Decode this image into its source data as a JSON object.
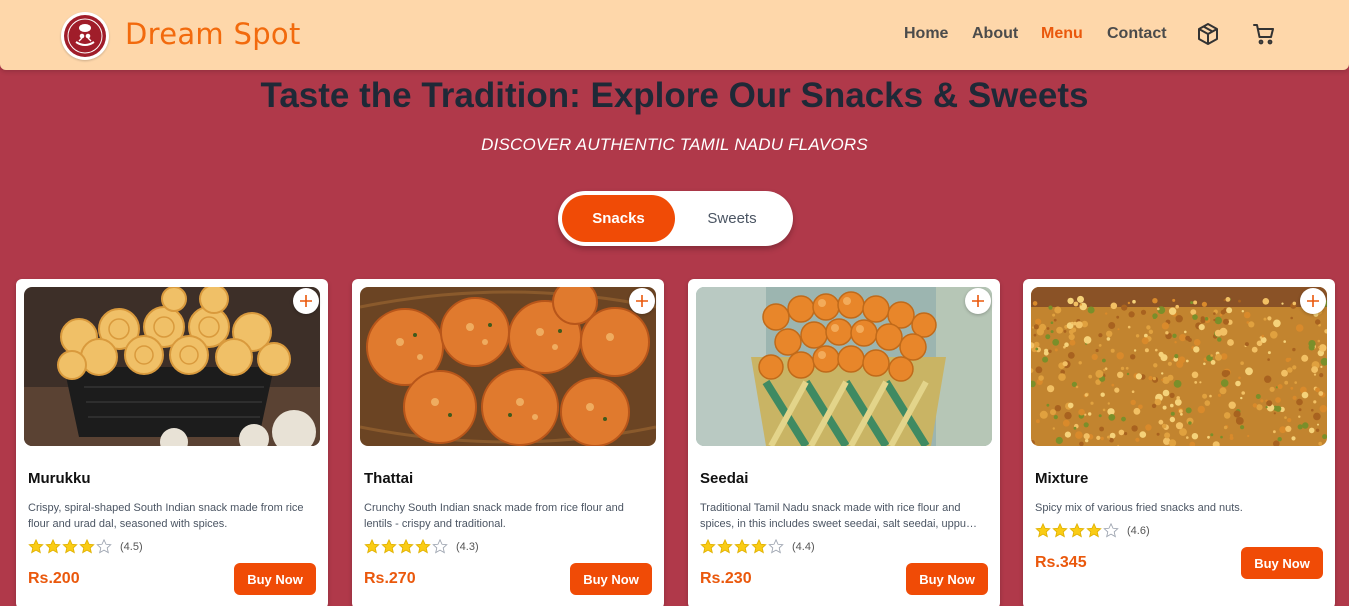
{
  "header": {
    "brand": "Dream Spot",
    "nav": [
      {
        "label": "Home",
        "active": false
      },
      {
        "label": "About",
        "active": false
      },
      {
        "label": "Menu",
        "active": true
      },
      {
        "label": "Contact",
        "active": false
      }
    ],
    "icons": [
      "package-icon",
      "cart-icon"
    ],
    "background_color": "#fed7aa",
    "accent_color": "#ea580c"
  },
  "hero": {
    "title": "Taste the Tradition: Explore Our Snacks & Sweets",
    "subtitle": "DISCOVER AUTHENTIC TAMIL NADU FLAVORS"
  },
  "category_toggle": {
    "options": [
      "Snacks",
      "Sweets"
    ],
    "selected": "Snacks"
  },
  "products": [
    {
      "name": "Murukku",
      "description": "Crispy, spiral-shaped South Indian snack made from rice flour and urad dal, seasoned with spices.",
      "rating": 4.5,
      "rating_text": "(4.5)",
      "price": "Rs.200",
      "button": "Buy Now"
    },
    {
      "name": "Thattai",
      "description": "Crunchy South Indian snack made from rice flour and lentils - crispy and traditional.",
      "rating": 4.3,
      "rating_text": "(4.3)",
      "price": "Rs.270",
      "button": "Buy Now"
    },
    {
      "name": "Seedai",
      "description": "Traditional Tamil Nadu snack made with rice flour and spices, in this includes sweet seedai, salt seedai, uppu seedai and more.",
      "rating": 4.4,
      "rating_text": "(4.4)",
      "price": "Rs.230",
      "button": "Buy Now"
    },
    {
      "name": "Mixture",
      "description": "Spicy mix of various fried snacks and nuts.",
      "rating": 4.6,
      "rating_text": "(4.6)",
      "price": "Rs.345",
      "button": "Buy Now"
    }
  ],
  "colors": {
    "page_background": "#b0394a",
    "button": "#f04b06",
    "star": "#facc15"
  }
}
